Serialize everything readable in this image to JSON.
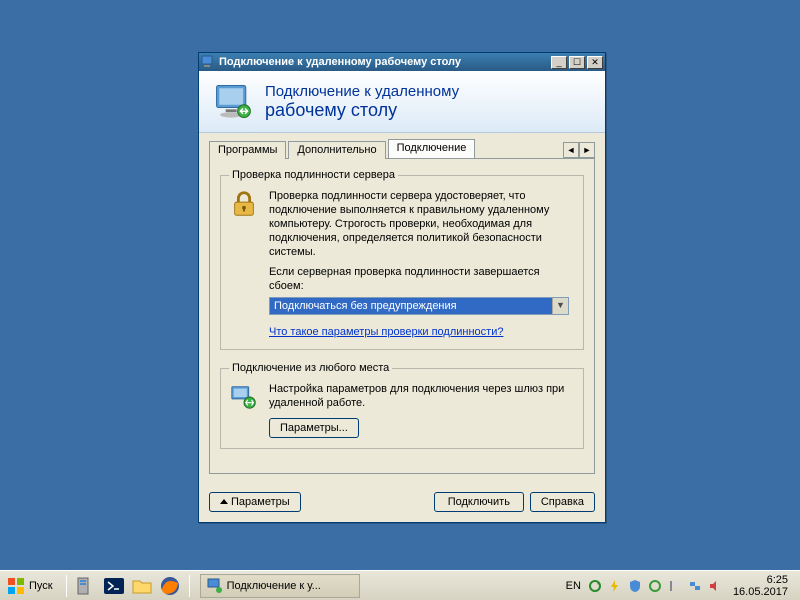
{
  "window": {
    "title": "Подключение к удаленному рабочему столу",
    "banner_line1": "Подключение к удаленному",
    "banner_line2": "рабочему столу",
    "tabs": [
      "Программы",
      "Дополнительно",
      "Подключение"
    ],
    "active_tab_index": 2,
    "group_auth": {
      "legend": "Проверка подлинности сервера",
      "desc": "Проверка подлинности сервера удостоверяет, что подключение выполняется к правильному удаленному компьютеру. Строгость проверки, необходимая для подключения, определяется политикой безопасности системы.",
      "prompt": "Если серверная проверка подлинности завершается сбоем:",
      "dropdown_value": "Подключаться без предупреждения",
      "help_link": "Что такое параметры проверки подлинности?"
    },
    "group_anywhere": {
      "legend": "Подключение из любого места",
      "desc": "Настройка параметров для подключения через шлюз при удаленной работе.",
      "params_button": "Параметры..."
    },
    "footer": {
      "options_toggle": "Параметры",
      "connect": "Подключить",
      "help": "Справка"
    }
  },
  "taskbar": {
    "start": "Пуск",
    "task_button": "Подключение к у...",
    "lang": "EN",
    "time": "6:25",
    "date": "16.05.2017"
  }
}
